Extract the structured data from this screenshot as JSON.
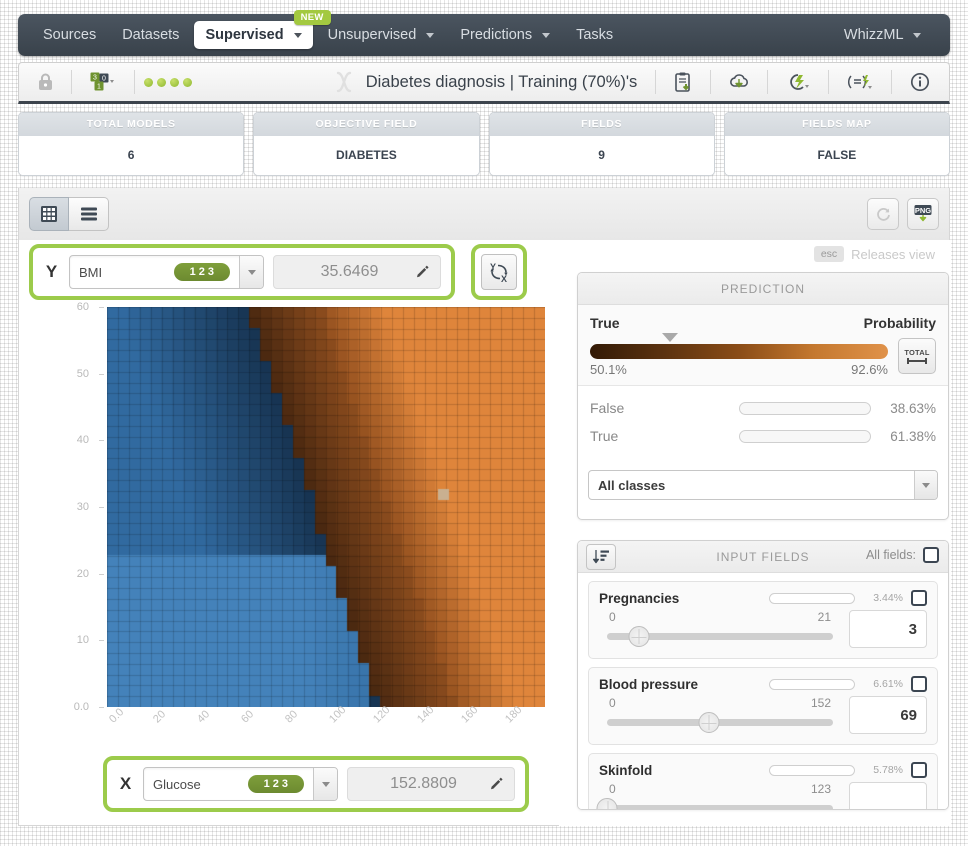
{
  "nav": {
    "items": [
      {
        "label": "Sources",
        "caret": false,
        "active": false,
        "badge": ""
      },
      {
        "label": "Datasets",
        "caret": false,
        "active": false,
        "badge": ""
      },
      {
        "label": "Supervised",
        "caret": true,
        "active": true,
        "badge": "NEW"
      },
      {
        "label": "Unsupervised",
        "caret": true,
        "active": false,
        "badge": ""
      },
      {
        "label": "Predictions",
        "caret": true,
        "active": false,
        "badge": ""
      },
      {
        "label": "Tasks",
        "caret": false,
        "active": false,
        "badge": ""
      }
    ],
    "right": {
      "label": "WhizzML",
      "caret": true
    }
  },
  "header": {
    "title": "Diabetes diagnosis | Training (70%)'s",
    "lock_icon": "lock-icon",
    "models_icon": "model-count-icon",
    "status_dots": 4,
    "icons": [
      {
        "name": "clipboard-download-icon"
      },
      {
        "name": "cloud-download-icon"
      },
      {
        "name": "batch-prediction-icon"
      },
      {
        "name": "equation-icon"
      },
      {
        "name": "info-icon"
      }
    ]
  },
  "stats": [
    {
      "label": "TOTAL MODELS",
      "value": "6"
    },
    {
      "label": "OBJECTIVE FIELD",
      "value": "DIABETES"
    },
    {
      "label": "FIELDS",
      "value": "9"
    },
    {
      "label": "FIELDS MAP",
      "value": "FALSE"
    }
  ],
  "toolbar": {
    "view_grid": "grid-view",
    "view_list": "list-view",
    "refresh": "refresh-icon",
    "export_png": "PNG"
  },
  "axes": {
    "y": {
      "letter": "Y",
      "field": "BMI",
      "type_badge": "123",
      "value": "35.6469",
      "edit_icon": "pencil-icon"
    },
    "x": {
      "letter": "X",
      "field": "Glucose",
      "type_badge": "123",
      "value": "152.8809",
      "edit_icon": "pencil-icon"
    },
    "swap": "swap-axes-icon"
  },
  "esc": {
    "key": "esc",
    "label": "Releases view"
  },
  "prediction": {
    "header": "PREDICTION",
    "class_label": "True",
    "probability_label": "Probability",
    "range_min": "50.1%",
    "range_max": "92.6%",
    "marker_pct": 27,
    "total_button": "TOTAL",
    "classes": [
      {
        "name": "False",
        "pct": "38.63%",
        "value": 38.63,
        "color": "#2e72a8"
      },
      {
        "name": "True",
        "pct": "61.38%",
        "value": 61.38,
        "color": "#e0822f"
      }
    ],
    "filter": "All classes"
  },
  "input_fields": {
    "header": "INPUT FIELDS",
    "sort_icon": "sort-icon",
    "all_fields_label": "All fields:",
    "fields": [
      {
        "name": "Pregnancies",
        "importance": "3.44%",
        "importance_value": 3.44,
        "min": "0",
        "max": "21",
        "value": "3",
        "knob_pct": 14
      },
      {
        "name": "Blood pressure",
        "importance": "6.61%",
        "importance_value": 6.61,
        "min": "0",
        "max": "152",
        "value": "69",
        "knob_pct": 45
      },
      {
        "name": "Skinfold",
        "importance": "5.78%",
        "importance_value": 5.78,
        "min": "0",
        "max": "123",
        "value": "",
        "knob_pct": 0
      }
    ]
  },
  "chart_data": {
    "type": "heatmap",
    "title": "",
    "xlabel": "Glucose",
    "ylabel": "BMI",
    "xlim": [
      0,
      199
    ],
    "ylim": [
      0,
      67.1
    ],
    "xticks": [
      "0.0",
      "20",
      "40",
      "60",
      "80",
      "100",
      "120",
      "140",
      "160",
      "180"
    ],
    "yticks": [
      "0.0",
      "10",
      "20",
      "30",
      "40",
      "50",
      "60"
    ],
    "grid": true,
    "legend": "none",
    "classes": [
      "False",
      "True"
    ],
    "class_colors": {
      "False": "#2e72a8",
      "True": "#e0822f"
    },
    "marker": {
      "x": 152.8809,
      "y": 35.6469,
      "color": "#c9b090"
    },
    "cells_x": 40,
    "cells_y": 37,
    "description": "Partial dependence / decision region heatmap: blue (False) occupies the left and lower region, orange (True) the upper-right; darker shades indicate lower confidence near the boundary.",
    "regions": [
      {
        "class": "False",
        "shade": "light",
        "approx_x": [
          0,
          120
        ],
        "approx_y": [
          0,
          26
        ]
      },
      {
        "class": "False",
        "shade": "medium",
        "approx_x": [
          0,
          105
        ],
        "approx_y": [
          26,
          67
        ]
      },
      {
        "class": "False",
        "shade": "dark",
        "approx_x": [
          105,
          140
        ],
        "approx_y": [
          26,
          67
        ]
      },
      {
        "class": "True",
        "shade": "dark",
        "approx_x": [
          125,
          165
        ],
        "approx_y": [
          28,
          67
        ]
      },
      {
        "class": "True",
        "shade": "bright",
        "approx_x": [
          165,
          199
        ],
        "approx_y": [
          30,
          67
        ]
      }
    ]
  }
}
